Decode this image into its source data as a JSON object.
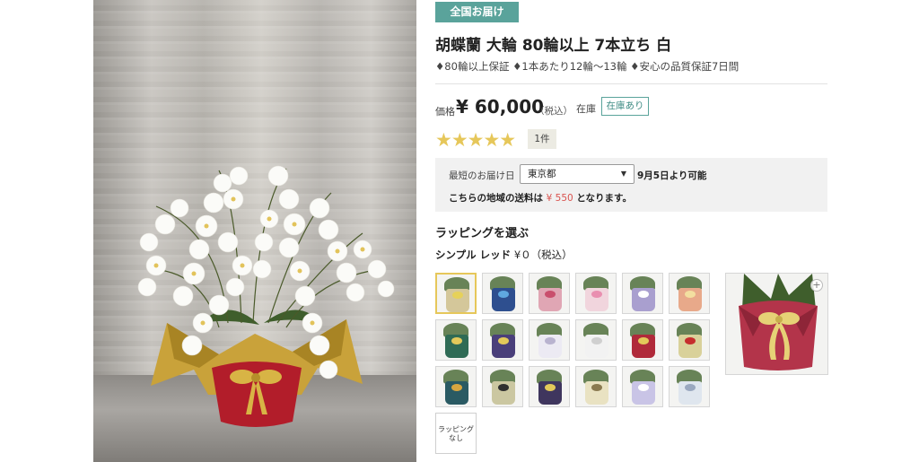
{
  "product": {
    "badge": "全国お届け",
    "title": "胡蝶蘭 大輪 80輪以上 7本立ち 白",
    "features": "♦80輪以上保証 ♦1本あたり12輪～13輪 ♦安心の品質保証7日間"
  },
  "pricing": {
    "label": "価格",
    "price": "¥ 60,000",
    "tax": "（税込）",
    "stock_label": "在庫",
    "stock_status": "在庫あり"
  },
  "rating": {
    "stars": "★★★★★",
    "value": 5,
    "max": 5,
    "count": "1件"
  },
  "delivery": {
    "label": "最短のお届け日",
    "region": "東京都",
    "available": "9月5日より可能",
    "ship_prefix": "こちらの地域の送料は",
    "ship_fee": "¥ 550",
    "ship_suffix": "となります。"
  },
  "wrapping": {
    "heading": "ラッピングを選ぶ",
    "selected_name": "シンプル レッド",
    "selected_price": "¥０（税込）",
    "none_label_1": "ラッピング",
    "none_label_2": "なし",
    "options": [
      {
        "paper": "#d4c79a",
        "ribbon": "#e6d15a"
      },
      {
        "paper": "#2e4f8f",
        "ribbon": "#5fa8e0"
      },
      {
        "paper": "#e0a6b4",
        "ribbon": "#c94f6d"
      },
      {
        "paper": "#f1d5dd",
        "ribbon": "#e98fb0"
      },
      {
        "paper": "#a99fcf",
        "ribbon": "#ffffff"
      },
      {
        "paper": "#e8a98a",
        "ribbon": "#f3dfa0"
      },
      {
        "paper": "#2f6b55",
        "ribbon": "#e3c95a"
      },
      {
        "paper": "#4a3f7a",
        "ribbon": "#e3c95a"
      },
      {
        "paper": "#eceaf3",
        "ribbon": "#b9b3cf"
      },
      {
        "paper": "#f2f2f2",
        "ribbon": "#cfcfcf"
      },
      {
        "paper": "#b02a3a",
        "ribbon": "#e3c95a"
      },
      {
        "paper": "#d9d19a",
        "ribbon": "#c62d2d"
      },
      {
        "paper": "#2a5a63",
        "ribbon": "#d8a640"
      },
      {
        "paper": "#cbc7a1",
        "ribbon": "#2f2f2f"
      },
      {
        "paper": "#3f365e",
        "ribbon": "#e3c95a"
      },
      {
        "paper": "#e9e2c2",
        "ribbon": "#8a7a50"
      },
      {
        "paper": "#c9c4e6",
        "ribbon": "#ffffff"
      },
      {
        "paper": "#dfe6ee",
        "ribbon": "#9aa8bf"
      }
    ]
  }
}
